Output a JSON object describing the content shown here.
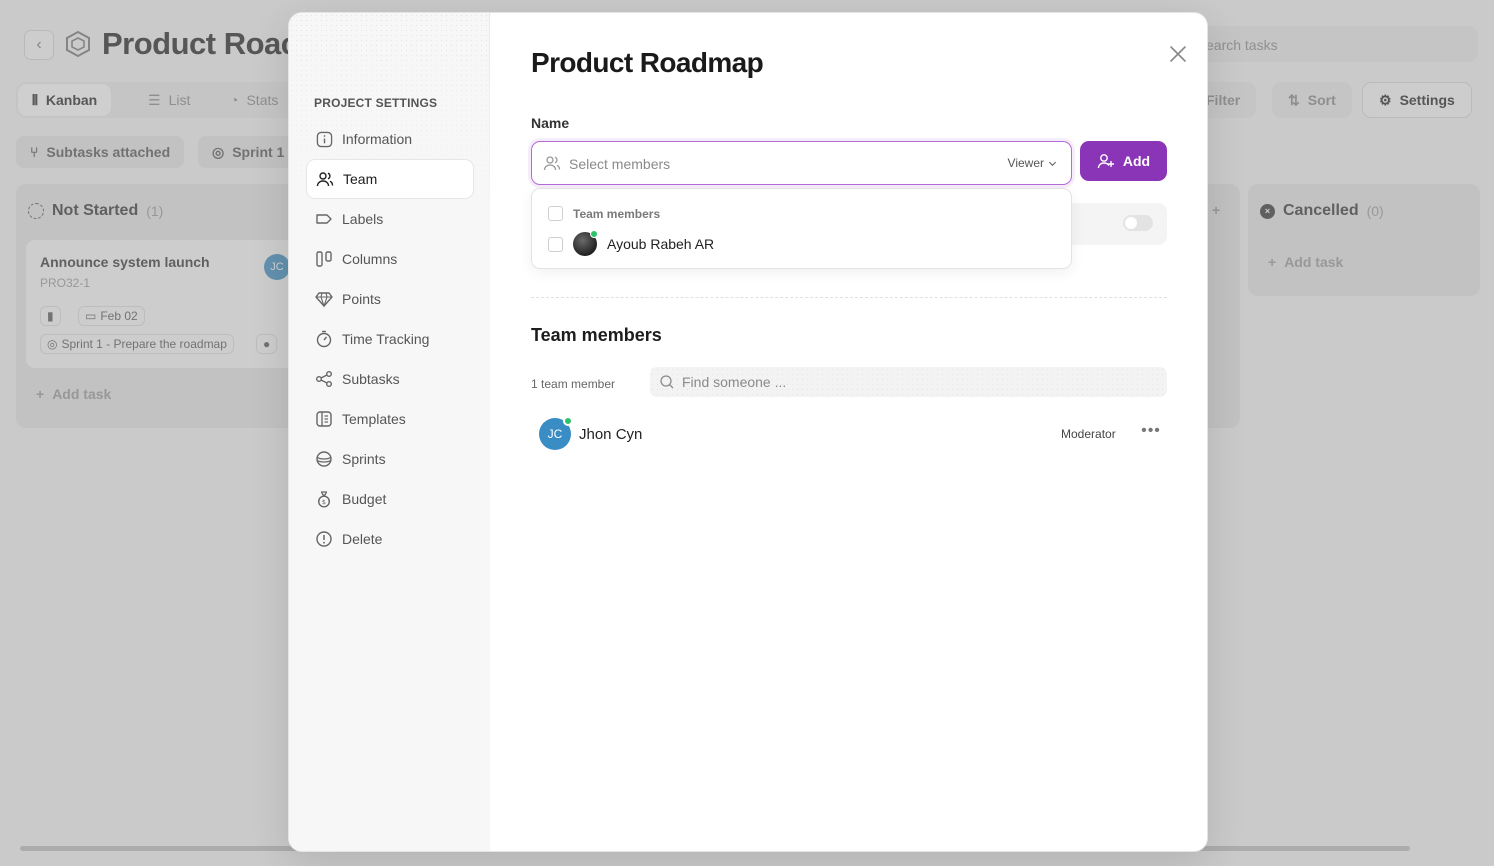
{
  "background": {
    "title": "Product Roac",
    "search_placeholder": "earch tasks",
    "view_tabs": [
      {
        "label": "Kanban",
        "icon": "kanban-icon"
      },
      {
        "label": "List",
        "icon": "list-icon"
      },
      {
        "label": "Stats",
        "icon": "stats-icon"
      }
    ],
    "toolbar": {
      "filter": "Filter",
      "sort": "Sort",
      "settings": "Settings"
    },
    "chips": [
      "Subtasks attached",
      "Sprint 1"
    ],
    "columns": [
      {
        "title": "Not Started",
        "count": "(1)"
      },
      {
        "title": "Cancelled",
        "count": "(0)"
      }
    ],
    "card": {
      "title": "Announce system launch",
      "id": "PRO32-1",
      "date": "Feb 02",
      "sprint": "Sprint 1 - Prepare the roadmap",
      "assignee_initials": "JC"
    },
    "add_task": "Add task"
  },
  "modal": {
    "sidebar": {
      "heading": "PROJECT SETTINGS",
      "items": [
        {
          "label": "Information",
          "icon": "info-icon"
        },
        {
          "label": "Team",
          "icon": "users-icon",
          "active": true
        },
        {
          "label": "Labels",
          "icon": "label-icon"
        },
        {
          "label": "Columns",
          "icon": "columns-icon"
        },
        {
          "label": "Points",
          "icon": "diamond-icon"
        },
        {
          "label": "Time Tracking",
          "icon": "stopwatch-icon"
        },
        {
          "label": "Subtasks",
          "icon": "subtasks-icon"
        },
        {
          "label": "Templates",
          "icon": "template-icon"
        },
        {
          "label": "Sprints",
          "icon": "sprint-icon"
        },
        {
          "label": "Budget",
          "icon": "money-bag-icon"
        },
        {
          "label": "Delete",
          "icon": "alert-circle-icon"
        }
      ]
    },
    "title": "Product Roadmap",
    "name_label": "Name",
    "select": {
      "placeholder": "Select members",
      "role": "Viewer"
    },
    "add_button": "Add",
    "dropdown": {
      "group_label": "Team members",
      "options": [
        {
          "name": "Ayoub Rabeh AR"
        }
      ]
    },
    "team_section": {
      "title": "Team members",
      "count_label": "1 team member",
      "search_placeholder": "Find someone ...",
      "members": [
        {
          "initials": "JC",
          "name": "Jhon Cyn",
          "role": "Moderator"
        }
      ]
    }
  },
  "colors": {
    "accent": "#8a35b8",
    "focus_ring": "#b46cd6",
    "online": "#2fc26b",
    "avatar_blue": "#3a8dc4"
  }
}
